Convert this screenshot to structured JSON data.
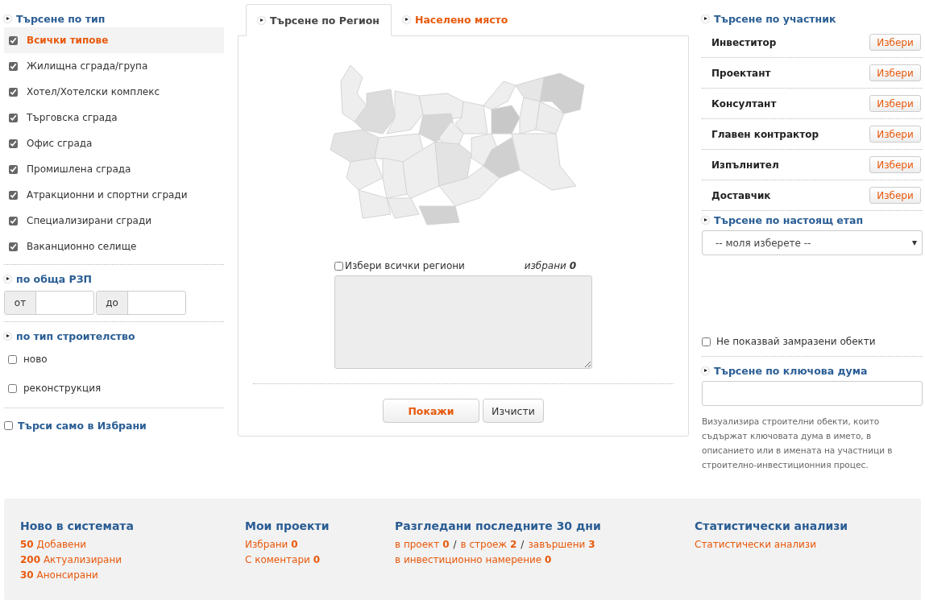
{
  "type_search": {
    "title": "Търсене по тип",
    "items": [
      {
        "label": "Всички типове",
        "checked": true,
        "selected": true
      },
      {
        "label": "Жилищна сграда/група",
        "checked": true,
        "selected": false
      },
      {
        "label": "Хотел/Хотелски комплекс",
        "checked": true,
        "selected": false
      },
      {
        "label": "Търговска сграда",
        "checked": true,
        "selected": false
      },
      {
        "label": "Офис сграда",
        "checked": true,
        "selected": false
      },
      {
        "label": "Промишлена сграда",
        "checked": true,
        "selected": false
      },
      {
        "label": "Атракционни и спортни сгради",
        "checked": true,
        "selected": false
      },
      {
        "label": "Специализирани сгради",
        "checked": true,
        "selected": false
      },
      {
        "label": "Ваканционно селище",
        "checked": true,
        "selected": false
      }
    ]
  },
  "area": {
    "title": "по обща РЗП",
    "from_label": "от",
    "to_label": "до"
  },
  "construction": {
    "title": "по тип строителство",
    "options": [
      {
        "label": "ново",
        "checked": false
      },
      {
        "label": "реконструкция",
        "checked": false
      }
    ]
  },
  "favorites_only": {
    "label": "Търси само в Избрани",
    "checked": false
  },
  "tabs": [
    {
      "label": "Търсене по Регион",
      "selected": true
    },
    {
      "label": "Населено място",
      "selected": false
    }
  ],
  "region": {
    "select_all": {
      "label": "Избери всички региони",
      "checked": false
    },
    "selected_text": "избрани **0**"
  },
  "buttons": [
    {
      "label": "Покажи",
      "kind": "primary"
    },
    {
      "label": "Изчисти",
      "kind": "secondary"
    }
  ],
  "participants": {
    "title": "Търсене по участник",
    "rows": [
      {
        "label": "Инвеститор",
        "button": "Избери"
      },
      {
        "label": "Проектант",
        "button": "Избери"
      },
      {
        "label": "Консултант",
        "button": "Избери"
      },
      {
        "label": "Главен контрактор",
        "button": "Избери"
      },
      {
        "label": "Изпълнител",
        "button": "Избери"
      },
      {
        "label": "Доставчик",
        "button": "Избери"
      }
    ]
  },
  "stage": {
    "title": "Търсене по настоящ етап",
    "value": "-- моля изберете --"
  },
  "hide_frozen": {
    "label": "Не показвай замразени обекти",
    "checked": false
  },
  "keyword": {
    "title": "Търсене по ключова дума",
    "hint": "Визуализира строителни обекти, които съдържат ключовата дума в името, в описанието или в имената на участници в строително-инвестиционния процес."
  },
  "footer": [
    {
      "title": "Ново в системата",
      "lines": [
        {
          "links": [
            "**50** Добавени"
          ]
        },
        {
          "links": [
            "**200** Актуализирани"
          ]
        },
        {
          "links": [
            "**30** Анонсирани"
          ]
        }
      ]
    },
    {
      "title": "Мои проекти",
      "lines": [
        {
          "links": [
            "Избрани **0**"
          ]
        },
        {
          "links": [
            "С коментари **0**"
          ]
        }
      ]
    },
    {
      "title": "Разгледани последните 30 дни",
      "lines": [
        {
          "links": [
            "в проект **0**",
            "в строеж **2**",
            "завършени **3**"
          ],
          "separator": "/"
        },
        {
          "links": [
            "в инвестиционно намерение **0**"
          ]
        }
      ]
    },
    {
      "title": "Статистически анализи",
      "lines": [
        {
          "links": [
            "Статистически анализи"
          ]
        }
      ]
    }
  ]
}
